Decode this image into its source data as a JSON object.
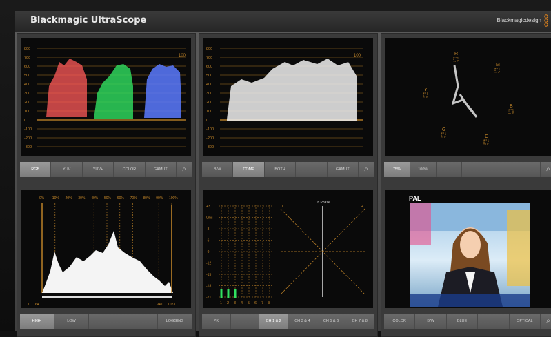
{
  "app": {
    "title": "Blackmagic UltraScope",
    "brand": "Blackmagicdesign"
  },
  "panels": {
    "parade": {
      "scale_labels": [
        "800",
        "700",
        "600",
        "500",
        "400",
        "300",
        "200",
        "100",
        "0",
        "-100",
        "-200",
        "-300"
      ],
      "marker": "100",
      "buttons": [
        "RGB",
        "YUV",
        "YUV+",
        "COLOR",
        "GAMUT"
      ],
      "active": "RGB"
    },
    "waveform": {
      "scale_labels": [
        "800",
        "700",
        "600",
        "500",
        "400",
        "300",
        "200",
        "100",
        "0",
        "-100",
        "-200",
        "-300"
      ],
      "marker": "100",
      "buttons": [
        "B/W",
        "COMP",
        "BOTH",
        "",
        "GAMUT"
      ],
      "active": "COMP"
    },
    "vectorscope": {
      "targets": [
        "R",
        "M",
        "B",
        "C",
        "G",
        "Y"
      ],
      "buttons": [
        "75%",
        "100%",
        "",
        "",
        "",
        ""
      ],
      "active": "75%"
    },
    "histogram": {
      "top_labels": [
        "0%",
        "10%",
        "20%",
        "30%",
        "40%",
        "50%",
        "60%",
        "70%",
        "80%",
        "90%",
        "100%"
      ],
      "bottom_left": [
        "0",
        "64"
      ],
      "bottom_right": [
        "940",
        "1023"
      ],
      "buttons": [
        "HIGH",
        "LOW",
        "",
        "",
        "LOGGING"
      ],
      "active": "HIGH"
    },
    "audio": {
      "db_labels": [
        "+3",
        "0ms",
        "-3",
        "-6",
        "-9",
        "-12",
        "-15",
        "-18",
        "-21"
      ],
      "channels": [
        "1",
        "2",
        "3",
        "4",
        "5",
        "6",
        "7",
        "8"
      ],
      "phase_label": "In Phase",
      "corner_labels": [
        "L",
        "R"
      ],
      "buttons": [
        "PK",
        "",
        "CH 1 & 2",
        "CH 3 & 4",
        "CH 5 & 6",
        "CH 7 & 8"
      ],
      "active": "CH 1 & 2"
    },
    "picture": {
      "format": "PAL",
      "buttons": [
        "COLOR",
        "B/W",
        "BLUE",
        "",
        "OPTICAL"
      ],
      "active": ""
    }
  },
  "colors": {
    "grid": "#c98a2a",
    "red_trace": "#ff6a6a",
    "green_trace": "#3dff6a",
    "blue_trace": "#5a7bff"
  }
}
